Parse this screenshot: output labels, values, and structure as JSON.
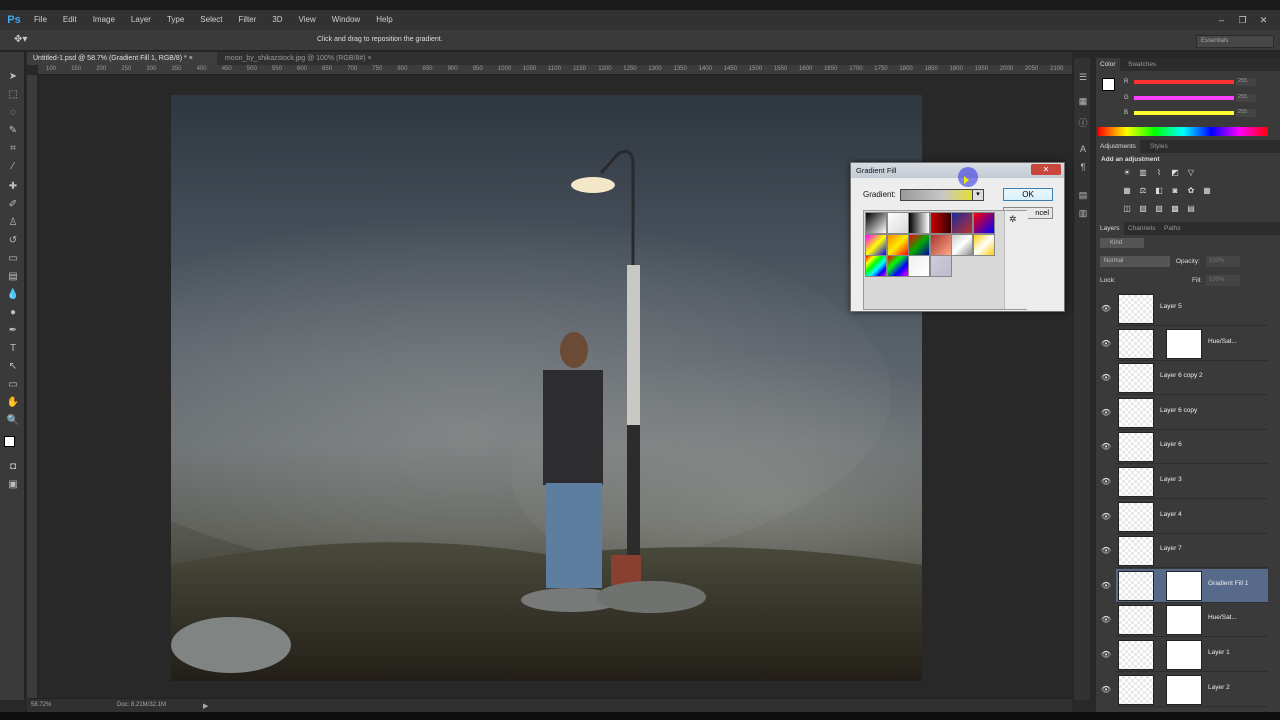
{
  "app": {
    "logo": "Ps"
  },
  "menu": [
    "File",
    "Edit",
    "Image",
    "Layer",
    "Type",
    "Select",
    "Filter",
    "3D",
    "View",
    "Window",
    "Help"
  ],
  "options_bar": {
    "hint": "Click and drag to reposition the gradient.",
    "workspace": "Essentials"
  },
  "tabs": [
    {
      "label": "Untitled-1.psd @ 58.7% (Gradient Fill 1, RGB/8) *",
      "close": "×"
    },
    {
      "label": "moon_by_shikazstock.jpg @ 100% (RGB/8#)",
      "close": "×"
    }
  ],
  "ruler_ticks": [
    "100",
    "150",
    "200",
    "250",
    "300",
    "350",
    "400",
    "450",
    "500",
    "550",
    "600",
    "650",
    "700",
    "750",
    "800",
    "850",
    "900",
    "950",
    "1000",
    "1050",
    "1100",
    "1150",
    "1200",
    "1250",
    "1300",
    "1350",
    "1400",
    "1450",
    "1500",
    "1550",
    "1600",
    "1650",
    "1700",
    "1750",
    "1800",
    "1850",
    "1900",
    "1950",
    "2000",
    "2050",
    "2100",
    "2150",
    "2200"
  ],
  "status": {
    "zoom": "58.72%",
    "doc": "Doc: 8.21M/32.1M"
  },
  "color_panel": {
    "tabs": [
      "Color",
      "Swatches"
    ],
    "channels": [
      {
        "label": "R",
        "value": "255",
        "color": "#ff3030"
      },
      {
        "label": "G",
        "value": "255",
        "color": "#ff40ff"
      },
      {
        "label": "B",
        "value": "255",
        "color": "#ffff30"
      }
    ]
  },
  "adjustments_panel": {
    "tabs": [
      "Adjustments",
      "Styles"
    ],
    "heading": "Add an adjustment"
  },
  "layers_panel": {
    "tabs": [
      "Layers",
      "Channels",
      "Paths"
    ],
    "filter_kind": "Kind",
    "blend_mode": "Normal",
    "opacity_label": "Opacity:",
    "opacity_value": "100%",
    "lock_label": "Lock:",
    "fill_label": "Fill:",
    "fill_value": "100%",
    "layers": [
      {
        "name": "Layer 5",
        "mask": false,
        "selected": false
      },
      {
        "name": "Hue/Sat...",
        "mask": true,
        "selected": false
      },
      {
        "name": "Layer 6 copy 2",
        "mask": false,
        "selected": false
      },
      {
        "name": "Layer 6 copy",
        "mask": false,
        "selected": false
      },
      {
        "name": "Layer 6",
        "mask": false,
        "selected": false
      },
      {
        "name": "Layer 3",
        "mask": false,
        "selected": false
      },
      {
        "name": "Layer 4",
        "mask": false,
        "selected": false
      },
      {
        "name": "Layer 7",
        "mask": false,
        "selected": false
      },
      {
        "name": "Gradient Fill 1",
        "mask": true,
        "selected": true
      },
      {
        "name": "Hue/Sat...",
        "mask": true,
        "selected": false
      },
      {
        "name": "Layer 1",
        "mask": true,
        "selected": false
      },
      {
        "name": "Layer 2",
        "mask": true,
        "selected": false
      }
    ]
  },
  "dialog": {
    "title": "Gradient Fill",
    "close": "✕",
    "gradient_label": "Gradient:",
    "ok": "OK",
    "cancel": "ncel",
    "gear": "✲"
  }
}
